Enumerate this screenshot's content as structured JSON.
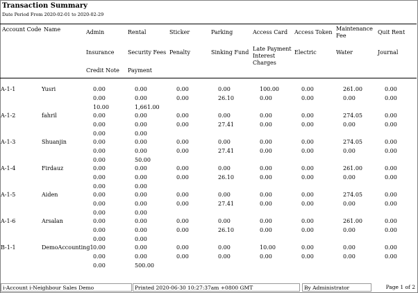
{
  "report": {
    "title": "Transaction Summary",
    "subtitle": "Date Period From 2020-02-01 to 2020-02-29"
  },
  "headers": {
    "account_code": "Account Code",
    "name": "Name",
    "row1": [
      "Admin",
      "Rental",
      "Sticker",
      "Parking",
      "Access Card",
      "Access Token",
      "Maintenance Fee",
      "Quit Rent"
    ],
    "row2": [
      "Insurance",
      "Security Fees",
      "Penalty",
      "Sinking Fund",
      "Late Payment Interest Charges",
      "Electric",
      "Water",
      "Journal"
    ],
    "row3": [
      "Credit Note",
      "Payment"
    ]
  },
  "rows": [
    {
      "code": "A-1-1",
      "name": "Yusri",
      "l1": [
        "0.00",
        "0.00",
        "0.00",
        "0.00",
        "100.00",
        "0.00",
        "261.00",
        "0.00"
      ],
      "l2": [
        "0.00",
        "0.00",
        "0.00",
        "26.10",
        "0.00",
        "0.00",
        "0.00",
        "0.00"
      ],
      "l3": [
        "10.00",
        "1,661.00"
      ]
    },
    {
      "code": "A-1-2",
      "name": "fahril",
      "l1": [
        "0.00",
        "0.00",
        "0.00",
        "0.00",
        "0.00",
        "0.00",
        "274.05",
        "0.00"
      ],
      "l2": [
        "0.00",
        "0.00",
        "0.00",
        "27.41",
        "0.00",
        "0.00",
        "0.00",
        "0.00"
      ],
      "l3": [
        "0.00",
        "0.00"
      ]
    },
    {
      "code": "A-1-3",
      "name": "Shuanjin",
      "l1": [
        "0.00",
        "0.00",
        "0.00",
        "0.00",
        "0.00",
        "0.00",
        "274.05",
        "0.00"
      ],
      "l2": [
        "0.00",
        "0.00",
        "0.00",
        "27.41",
        "0.00",
        "0.00",
        "0.00",
        "0.00"
      ],
      "l3": [
        "0.00",
        "50.00"
      ]
    },
    {
      "code": "A-1-4",
      "name": "Firdauz",
      "l1": [
        "0.00",
        "0.00",
        "0.00",
        "0.00",
        "0.00",
        "0.00",
        "261.00",
        "0.00"
      ],
      "l2": [
        "0.00",
        "0.00",
        "0.00",
        "26.10",
        "0.00",
        "0.00",
        "0.00",
        "0.00"
      ],
      "l3": [
        "0.00",
        "0.00"
      ]
    },
    {
      "code": "A-1-5",
      "name": "Aiden",
      "l1": [
        "0.00",
        "0.00",
        "0.00",
        "0.00",
        "0.00",
        "0.00",
        "274.05",
        "0.00"
      ],
      "l2": [
        "0.00",
        "0.00",
        "0.00",
        "27.41",
        "0.00",
        "0.00",
        "0.00",
        "0.00"
      ],
      "l3": [
        "0.00",
        "0.00"
      ]
    },
    {
      "code": "A-1-6",
      "name": "Arsalan",
      "l1": [
        "0.00",
        "0.00",
        "0.00",
        "0.00",
        "0.00",
        "0.00",
        "261.00",
        "0.00"
      ],
      "l2": [
        "0.00",
        "0.00",
        "0.00",
        "26.10",
        "0.00",
        "0.00",
        "0.00",
        "0.00"
      ],
      "l3": [
        "0.00",
        "0.00"
      ]
    },
    {
      "code": "B-1-1",
      "name": "DemoAccounting1",
      "l1": [
        "0.00",
        "0.00",
        "0.00",
        "0.00",
        "10.00",
        "0.00",
        "0.00",
        "0.00"
      ],
      "l2": [
        "0.00",
        "0.00",
        "0.00",
        "0.00",
        "0.00",
        "0.00",
        "0.00",
        "0.00"
      ],
      "l3": [
        "0.00",
        "500.00"
      ]
    }
  ],
  "footer": {
    "company": "i-Account i-Neighbour Sales Demo",
    "printed": "Printed 2020-06-30 10:27:37am +0800 GMT",
    "by": "By Administrator",
    "page": "Page 1 of 2"
  }
}
